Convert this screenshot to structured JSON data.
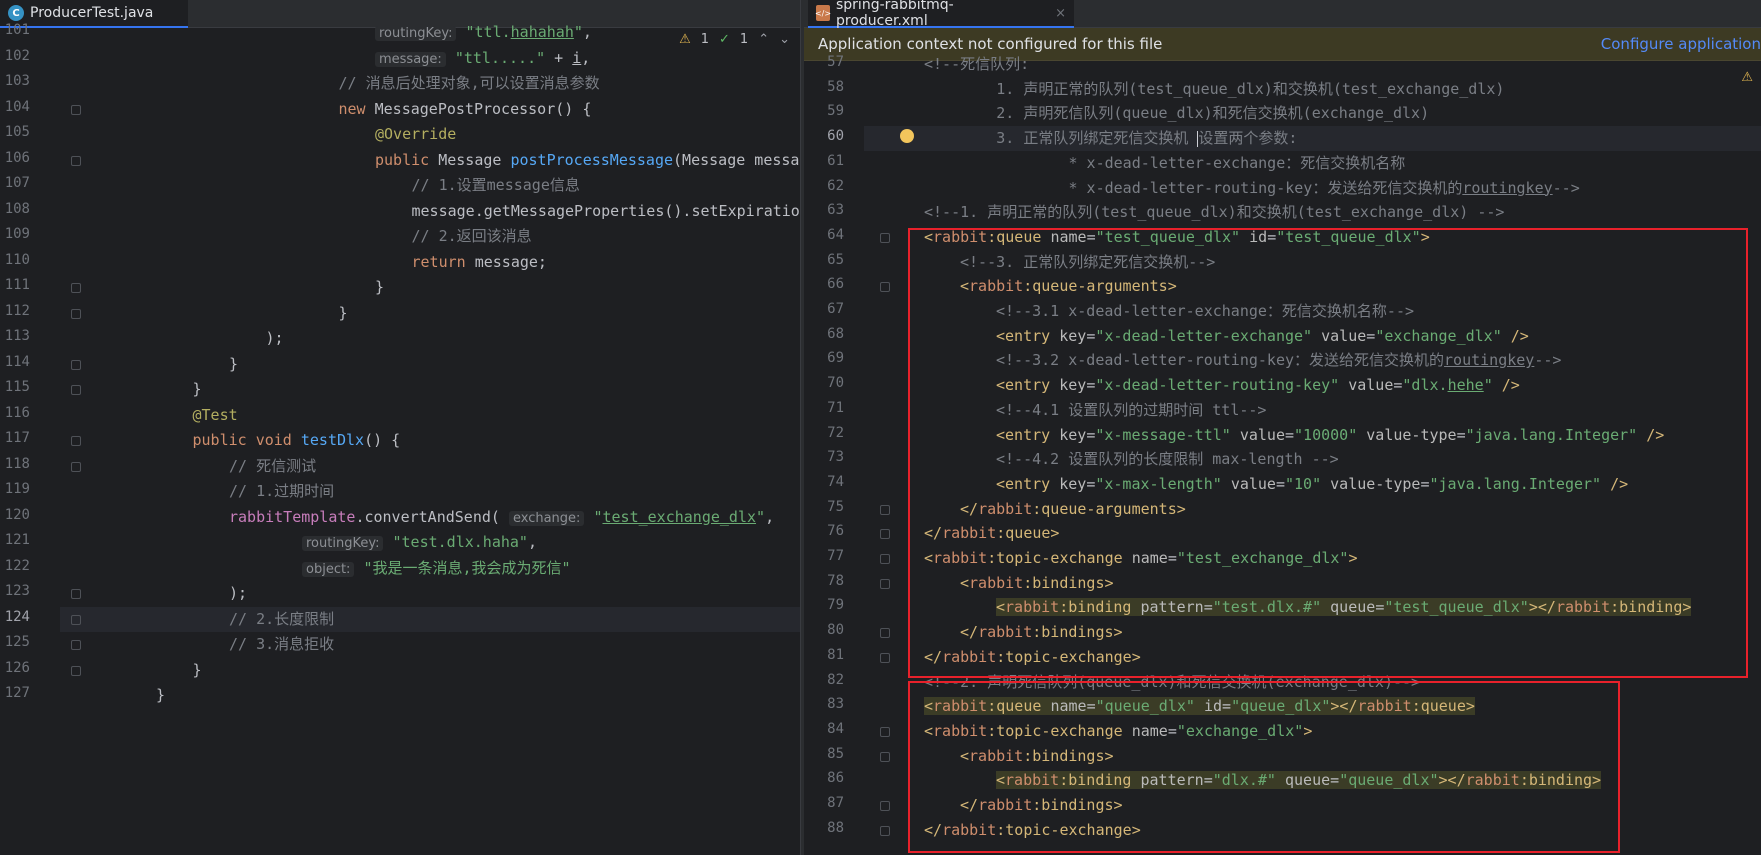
{
  "left_tab": {
    "icon": "java-class-icon",
    "title": "ProducerTest.java"
  },
  "right_tab": {
    "icon": "xml-file-icon",
    "title": "spring-rabbitmq-producer.xml",
    "close": "×"
  },
  "inspections": {
    "warnings": "1",
    "checks": "1"
  },
  "banner": {
    "message": "Application context not configured for this file",
    "link": "Configure application"
  },
  "left_lines": [
    {
      "n": "101",
      "html": "<span class='hint'>routingKey:</span> <span class='str'>\"ttl.<u>hahahah</u>\"</span>,",
      "indent": 8
    },
    {
      "n": "102",
      "html": "<span class='hint'>message:</span> <span class='str'>\"ttl.....\"</span> + <span class='plain'><u>i</u></span>,",
      "indent": 8
    },
    {
      "n": "103",
      "html": "<span class='cm'>// 消息后处理对象,可以设置消息参数</span>",
      "indent": 7
    },
    {
      "n": "104",
      "html": "<span class='kw'>new</span> MessagePostProcessor() {",
      "indent": 7
    },
    {
      "n": "105",
      "html": "<span class='ann'>@Override</span>",
      "indent": 8
    },
    {
      "n": "106",
      "html": "<span class='kw'>public</span> Message <span class='fn'>postProcessMessage</span>(Message messag",
      "indent": 8
    },
    {
      "n": "107",
      "html": "<span class='cm'>// 1.设置message信息</span>",
      "indent": 9
    },
    {
      "n": "108",
      "html": "message.getMessageProperties().setExpiration",
      "indent": 9
    },
    {
      "n": "109",
      "html": "<span class='cm'>// 2.返回该消息</span>",
      "indent": 9
    },
    {
      "n": "110",
      "html": "<span class='kw'>return</span> message;",
      "indent": 9
    },
    {
      "n": "111",
      "html": "}",
      "indent": 8
    },
    {
      "n": "112",
      "html": "}",
      "indent": 7
    },
    {
      "n": "113",
      "html": ");",
      "indent": 5
    },
    {
      "n": "114",
      "html": "}",
      "indent": 4
    },
    {
      "n": "115",
      "html": "}",
      "indent": 3
    },
    {
      "n": "116",
      "html": "<span class='ann'>@Test</span>",
      "indent": 3
    },
    {
      "n": "117",
      "html": "<span class='kw'>public void</span> <span class='fn'>testDlx</span>() {",
      "indent": 3
    },
    {
      "n": "118",
      "html": "<span class='cm'>// 死信测试</span>",
      "indent": 4
    },
    {
      "n": "119",
      "html": "<span class='cm'>// 1.过期时间</span>",
      "indent": 4
    },
    {
      "n": "120",
      "html": "<span class='field'>rabbitTemplate</span>.convertAndSend( <span class='hint'>exchange:</span> <span class='str'>\"<u>test_exchange_dlx</u>\"</span>,",
      "indent": 4
    },
    {
      "n": "121",
      "html": "<span class='hint'>routingKey:</span> <span class='str'>\"test.dlx.haha\"</span>,",
      "indent": 6
    },
    {
      "n": "122",
      "html": "<span class='hint'>object:</span> <span class='str'>\"我是一条消息,我会成为死信\"</span>",
      "indent": 6
    },
    {
      "n": "123",
      "html": ");",
      "indent": 4
    },
    {
      "n": "124",
      "html": "<span class='cm'>// 2.长度限制</span>",
      "indent": 4
    },
    {
      "n": "125",
      "html": "<span class='cm'>// 3.消息拒收</span>",
      "indent": 4
    },
    {
      "n": "126",
      "html": "}",
      "indent": 3
    },
    {
      "n": "127",
      "html": "}",
      "indent": 2
    }
  ],
  "right_lines": [
    {
      "n": "57",
      "html": "<span class='xcm'>&lt;!--死信队列:</span>",
      "indent": 0
    },
    {
      "n": "58",
      "html": "<span class='xcm'>        1. 声明正常的队列(test_queue_dlx)和交换机(test_exchange_dlx)</span>",
      "indent": 0
    },
    {
      "n": "59",
      "html": "<span class='xcm'>        2. 声明死信队列(queue_dlx)和死信交换机(exchange_dlx)</span>",
      "indent": 0
    },
    {
      "n": "60",
      "html": "<span class='xcm'>        3. 正常队列绑定死信交换机 </span><span class='caret'></span><span class='xcm'>设置两个参数:</span>",
      "indent": 0
    },
    {
      "n": "61",
      "html": "<span class='xcm'>                * x-dead-letter-exchange：死信交换机名称</span>",
      "indent": 0
    },
    {
      "n": "62",
      "html": "<span class='xcm'>                * x-dead-letter-routing-key：发送给死信交换机的<u>routingkey</u>--&gt;</span>",
      "indent": 0
    },
    {
      "n": "63",
      "html": "<span class='xcm'>&lt;!--1. 声明正常的队列(test_queue_dlx)和交换机(test_exchange_dlx) --&gt;</span>",
      "indent": 0
    },
    {
      "n": "64",
      "html": "<span class='tag'>&lt;<span class='ns'>rabbit</span>:queue</span> <span class='attr'>name</span>=<span class='aval'>\"test_queue_dlx\"</span> <span class='attr'>id</span>=<span class='aval'>\"test_queue_dlx\"</span><span class='tag'>&gt;</span>",
      "indent": 0
    },
    {
      "n": "65",
      "html": "<span class='xcm'>&lt;!--3. 正常队列绑定死信交换机--&gt;</span>",
      "indent": 1
    },
    {
      "n": "66",
      "html": "<span class='tag'>&lt;<span class='ns'>rabbit</span>:queue-arguments&gt;</span>",
      "indent": 1
    },
    {
      "n": "67",
      "html": "<span class='xcm'>&lt;!--3.1 x-dead-letter-exchange：死信交换机名称--&gt;</span>",
      "indent": 2
    },
    {
      "n": "68",
      "html": "<span class='tag'>&lt;entry</span> <span class='attr'>key</span>=<span class='aval'>\"x-dead-letter-exchange\"</span> <span class='attr'>value</span>=<span class='aval'>\"exchange_dlx\"</span> <span class='tag'>/&gt;</span>",
      "indent": 2
    },
    {
      "n": "69",
      "html": "<span class='xcm'>&lt;!--3.2 x-dead-letter-routing-key：发送给死信交换机的<u>routingkey</u>--&gt;</span>",
      "indent": 2
    },
    {
      "n": "70",
      "html": "<span class='tag'>&lt;entry</span> <span class='attr'>key</span>=<span class='aval'>\"x-dead-letter-routing-key\"</span> <span class='attr'>value</span>=<span class='aval'>\"dlx.<u>hehe</u>\"</span> <span class='tag'>/&gt;</span>",
      "indent": 2
    },
    {
      "n": "71",
      "html": "<span class='xcm'>&lt;!--4.1 设置队列的过期时间 ttl--&gt;</span>",
      "indent": 2
    },
    {
      "n": "72",
      "html": "<span class='tag'>&lt;entry</span> <span class='attr'>key</span>=<span class='aval'>\"x-message-ttl\"</span> <span class='attr'>value</span>=<span class='aval'>\"10000\"</span> <span class='attr'>value-type</span>=<span class='aval'>\"java.lang.Integer\"</span> <span class='tag'>/&gt;</span>",
      "indent": 2
    },
    {
      "n": "73",
      "html": "<span class='xcm'>&lt;!--4.2 设置队列的长度限制 max-length --&gt;</span>",
      "indent": 2
    },
    {
      "n": "74",
      "html": "<span class='tag'>&lt;entry</span> <span class='attr'>key</span>=<span class='aval'>\"x-max-length\"</span> <span class='attr'>value</span>=<span class='aval'>\"10\"</span> <span class='attr'>value-type</span>=<span class='aval'>\"java.lang.Integer\"</span> <span class='tag'>/&gt;</span>",
      "indent": 2
    },
    {
      "n": "75",
      "html": "<span class='tag'>&lt;/<span class='ns'>rabbit</span>:queue-arguments&gt;</span>",
      "indent": 1
    },
    {
      "n": "76",
      "html": "<span class='tag'>&lt;/<span class='ns'>rabbit</span>:queue&gt;</span>",
      "indent": 0
    },
    {
      "n": "77",
      "html": "<span class='tag'>&lt;<span class='ns'>rabbit</span>:topic-exchange</span> <span class='attr'>name</span>=<span class='aval'>\"test_exchange_dlx\"</span><span class='tag'>&gt;</span>",
      "indent": 0
    },
    {
      "n": "78",
      "html": "<span class='tag'>&lt;<span class='ns'>rabbit</span>:bindings&gt;</span>",
      "indent": 1
    },
    {
      "n": "79",
      "html": "<span class='binding-bg'><span class='tag'>&lt;<span class='ns'>rabbit</span>:binding</span> <span class='attr'>pattern</span>=<span class='aval'>\"test.dlx.#\"</span> <span class='attr'>queue</span>=<span class='aval'>\"test_queue_dlx\"</span><span class='tag'>&gt;&lt;/<span class='ns'>rabbit</span>:binding&gt;</span></span>",
      "indent": 2
    },
    {
      "n": "80",
      "html": "<span class='tag'>&lt;/<span class='ns'>rabbit</span>:bindings&gt;</span>",
      "indent": 1
    },
    {
      "n": "81",
      "html": "<span class='tag'>&lt;/<span class='ns'>rabbit</span>:topic-exchange&gt;</span>",
      "indent": 0
    },
    {
      "n": "82",
      "html": "<span class='xcm'>&lt;!--2. 声明死信队列(queue_dlx)和死信交换机(exchange_dlx)--&gt;</span>",
      "indent": 0
    },
    {
      "n": "83",
      "html": "<span class='binding-bg'><span class='tag'>&lt;<span class='ns'>rabbit</span>:queue</span> <span class='attr'>name</span>=<span class='aval'>\"queue_dlx\"</span> <span class='attr'>id</span>=<span class='aval'>\"queue_dlx\"</span><span class='tag'>&gt;&lt;/<span class='ns'>rabbit</span>:queue&gt;</span></span>",
      "indent": 0
    },
    {
      "n": "84",
      "html": "<span class='tag'>&lt;<span class='ns'>rabbit</span>:topic-exchange</span> <span class='attr'>name</span>=<span class='aval'>\"exchange_dlx\"</span><span class='tag'>&gt;</span>",
      "indent": 0
    },
    {
      "n": "85",
      "html": "<span class='tag'>&lt;<span class='ns'>rabbit</span>:bindings&gt;</span>",
      "indent": 1
    },
    {
      "n": "86",
      "html": "<span class='binding-bg'><span class='tag'>&lt;<span class='ns'>rabbit</span>:binding</span> <span class='attr'>pattern</span>=<span class='aval'>\"dlx.#\"</span> <span class='attr'>queue</span>=<span class='aval'>\"queue_dlx\"</span><span class='tag'>&gt;&lt;/<span class='ns'>rabbit</span>:binding&gt;</span></span>",
      "indent": 2
    },
    {
      "n": "87",
      "html": "<span class='tag'>&lt;/<span class='ns'>rabbit</span>:bindings&gt;</span>",
      "indent": 1
    },
    {
      "n": "88",
      "html": "<span class='tag'>&lt;/<span class='ns'>rabbit</span>:topic-exchange&gt;</span>",
      "indent": 0
    }
  ]
}
